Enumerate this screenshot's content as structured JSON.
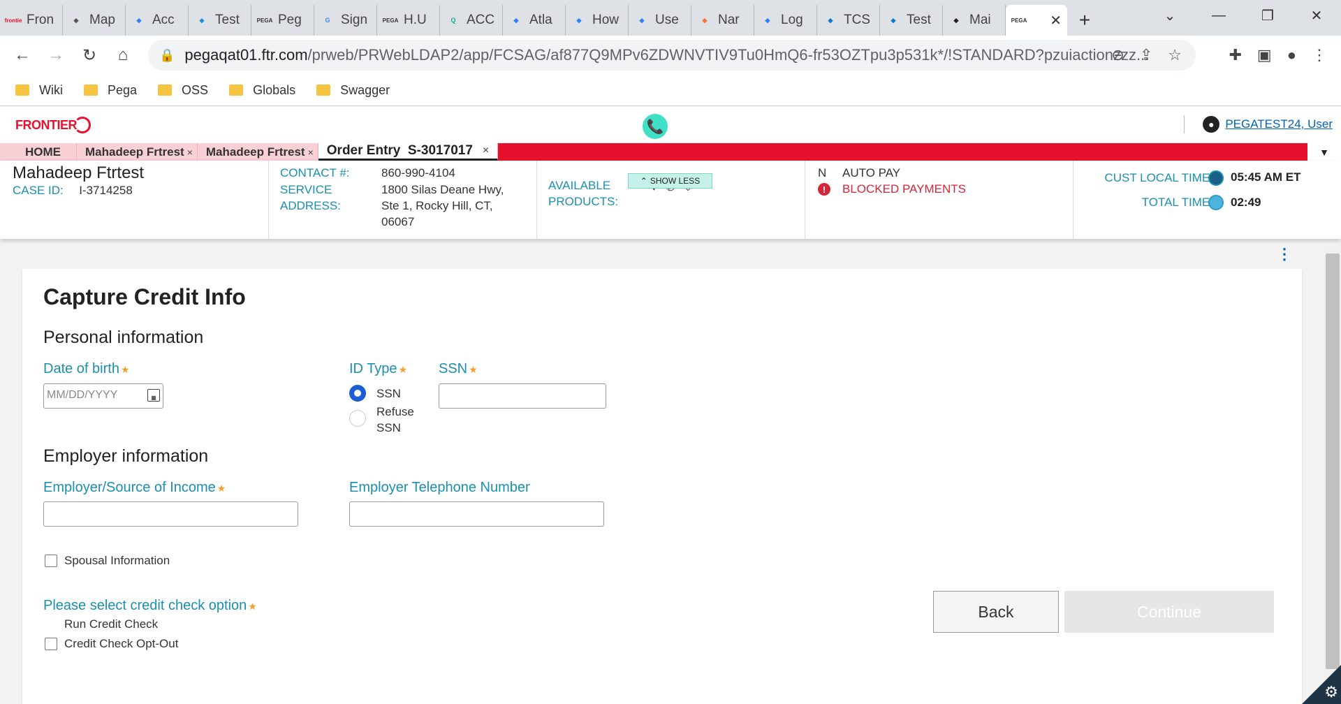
{
  "browser": {
    "tabs": [
      {
        "title": "Fron",
        "icon": "frontier-favicon",
        "icon_text": "frontie",
        "color": "#e8112d"
      },
      {
        "title": "Map",
        "icon": "globe-icon",
        "color": "#555"
      },
      {
        "title": "Acc",
        "icon": "jira-icon",
        "color": "#2684ff"
      },
      {
        "title": "Test",
        "icon": "zephyr-icon",
        "color": "#1c8fd6"
      },
      {
        "title": "Peg",
        "icon": "pega-favicon",
        "icon_text": "PEGA",
        "color": "#333"
      },
      {
        "title": "Sign",
        "icon": "google-icon",
        "icon_text": "G",
        "color": "#4285f4"
      },
      {
        "title": "H.U",
        "icon": "pega-favicon",
        "icon_text": "PEGA",
        "color": "#333"
      },
      {
        "title": "ACC",
        "icon": "q-icon",
        "icon_text": "Q",
        "color": "#1aa88a"
      },
      {
        "title": "Atla",
        "icon": "jira-icon",
        "color": "#2684ff"
      },
      {
        "title": "How",
        "icon": "atlassian-icon",
        "color": "#2684ff"
      },
      {
        "title": "Use",
        "icon": "jira-icon",
        "color": "#2684ff"
      },
      {
        "title": "Nar",
        "icon": "postman-icon",
        "color": "#ff6c37"
      },
      {
        "title": "Log",
        "icon": "atlassian-icon",
        "color": "#2684ff"
      },
      {
        "title": "TCS",
        "icon": "cloud-icon",
        "color": "#0b78d4"
      },
      {
        "title": "Test",
        "icon": "cloud-icon",
        "color": "#0b78d4"
      },
      {
        "title": "Mai",
        "icon": "github-icon",
        "color": "#222"
      }
    ],
    "active_tab": {
      "title": "",
      "icon_text": "PEGA",
      "close": "✕"
    },
    "new_tab": "+",
    "window_controls": [
      "⌄",
      "—",
      "❐",
      "✕"
    ],
    "url_host": "pegaqat01.ftr.com",
    "url_rest": "/prweb/PRWebLDAP2/app/FCSAG/af877Q9MPv6ZDWNVTIV9Tu0HmQ6-fr53OZTpu3p531k*/!STANDARD?pzuiactionzzz...",
    "bookmarks": [
      "Wiki",
      "Pega",
      "OSS",
      "Globals",
      "Swagger"
    ]
  },
  "app": {
    "brand": "FRONTIER",
    "user_link": "PEGATEST24, User",
    "work_tabs": [
      {
        "label": "HOME",
        "closable": false
      },
      {
        "label": "Mahadeep Frtrest",
        "closable": true
      },
      {
        "label": "Mahadeep Frtrest",
        "closable": true
      },
      {
        "label": "Order Entry  S-3017017",
        "closable": true,
        "active": true
      }
    ],
    "close_glyph": "×"
  },
  "case": {
    "customer_name": "Mahadeep Ftrtest",
    "case_id_label": "CASE ID:",
    "case_id": "I-3714258",
    "contact_label": "CONTACT #:",
    "contact": "860-990-4104",
    "service_label": "SERVICE",
    "address_label": "ADDRESS:",
    "address_line1": "1800 Silas Deane Hwy,",
    "address_line2": "Ste 1, Rocky Hill, CT,",
    "address_line3": "06067",
    "products_label1": "AVAILABLE",
    "products_label2": "PRODUCTS:",
    "autopay_flag": "N",
    "autopay_label": "AUTO PAY",
    "blocked_label": "BLOCKED PAYMENTS",
    "local_time_label": "CUST LOCAL TIME:",
    "local_time": "05:45 AM ET",
    "total_time_label": "TOTAL TIME:",
    "total_time": "02:49",
    "show_less": "SHOW LESS"
  },
  "form": {
    "title": "Capture Credit Info",
    "personal_heading": "Personal information",
    "dob_label": "Date of birth",
    "dob_placeholder": "MM/DD/YYYY",
    "id_type_label": "ID Type",
    "id_options": [
      "SSN",
      "Refuse",
      "SSN"
    ],
    "ssn_label": "SSN",
    "employer_heading": "Employer information",
    "employer_label": "Employer/Source of Income",
    "employer_phone_label": "Employer Telephone Number",
    "spousal_label": "Spousal Information",
    "credit_option_label": "Please select credit check option",
    "run_credit_label": "Run Credit Check",
    "opt_out_label": "Credit Check Opt-Out",
    "required_mark": "★",
    "back_label": "Back",
    "continue_label": "Continue"
  },
  "colors": {
    "brand_red": "#e8112d",
    "label_teal": "#1a8fb0",
    "radio_blue": "#1a5fd6",
    "link_blue": "#0062b8",
    "alert_red": "#d6263a"
  }
}
